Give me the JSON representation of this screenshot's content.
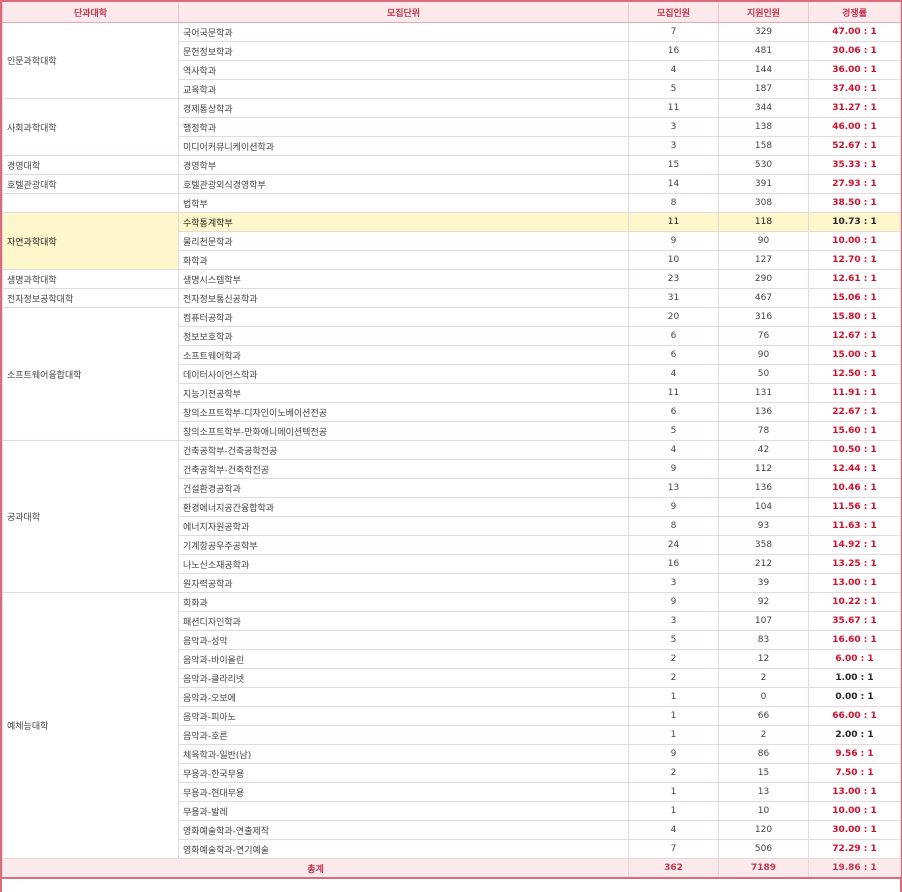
{
  "header": {
    "college": "단과대학",
    "dept": "모집단위",
    "quota": "모집인원",
    "applicants": "지원인원",
    "ratio": "경쟁률"
  },
  "colors": {
    "border": "#d96b7d",
    "header_bg": "#fbe9ec",
    "ratio_red": "#d0102a",
    "highlight_bg": "#fff7cc"
  },
  "highlight_college": "자연과학대학",
  "highlight_row": "수학통계학부",
  "low_ratio_rows": [
    "1.00 : 1",
    "0.00 : 1",
    "2.00 : 1"
  ],
  "colleges": [
    {
      "name": "인문과학대학",
      "rows": [
        {
          "dept": "국어국문학과",
          "quota": "7",
          "applicants": "329",
          "ratio": "47.00 : 1"
        },
        {
          "dept": "문헌정보학과",
          "quota": "16",
          "applicants": "481",
          "ratio": "30.06 : 1"
        },
        {
          "dept": "역사학과",
          "quota": "4",
          "applicants": "144",
          "ratio": "36.00 : 1"
        },
        {
          "dept": "교육학과",
          "quota": "5",
          "applicants": "187",
          "ratio": "37.40 : 1"
        }
      ]
    },
    {
      "name": "사회과학대학",
      "rows": [
        {
          "dept": "경제통상학과",
          "quota": "11",
          "applicants": "344",
          "ratio": "31.27 : 1"
        },
        {
          "dept": "행정학과",
          "quota": "3",
          "applicants": "138",
          "ratio": "46.00 : 1"
        },
        {
          "dept": "미디어커뮤니케이션학과",
          "quota": "3",
          "applicants": "158",
          "ratio": "52.67 : 1"
        }
      ]
    },
    {
      "name": "경영대학",
      "rows": [
        {
          "dept": "경영학부",
          "quota": "15",
          "applicants": "530",
          "ratio": "35.33 : 1"
        }
      ]
    },
    {
      "name": "호텔관광대학",
      "rows": [
        {
          "dept": "호텔관광외식경영학부",
          "quota": "14",
          "applicants": "391",
          "ratio": "27.93 : 1"
        }
      ]
    },
    {
      "name": "",
      "rows": [
        {
          "dept": "법학부",
          "quota": "8",
          "applicants": "308",
          "ratio": "38.50 : 1"
        }
      ]
    },
    {
      "name": "자연과학대학",
      "rows": [
        {
          "dept": "수학통계학부",
          "quota": "11",
          "applicants": "118",
          "ratio": "10.73 : 1"
        },
        {
          "dept": "물리천문학과",
          "quota": "9",
          "applicants": "90",
          "ratio": "10.00 : 1"
        },
        {
          "dept": "화학과",
          "quota": "10",
          "applicants": "127",
          "ratio": "12.70 : 1"
        }
      ]
    },
    {
      "name": "생명과학대학",
      "rows": [
        {
          "dept": "생명시스템학부",
          "quota": "23",
          "applicants": "290",
          "ratio": "12.61 : 1"
        }
      ]
    },
    {
      "name": "전자정보공학대학",
      "rows": [
        {
          "dept": "전자정보통신공학과",
          "quota": "31",
          "applicants": "467",
          "ratio": "15.06 : 1"
        }
      ]
    },
    {
      "name": "소프트웨어융합대학",
      "rows": [
        {
          "dept": "컴퓨터공학과",
          "quota": "20",
          "applicants": "316",
          "ratio": "15.80 : 1"
        },
        {
          "dept": "정보보호학과",
          "quota": "6",
          "applicants": "76",
          "ratio": "12.67 : 1"
        },
        {
          "dept": "소프트웨어학과",
          "quota": "6",
          "applicants": "90",
          "ratio": "15.00 : 1"
        },
        {
          "dept": "데이터사이언스학과",
          "quota": "4",
          "applicants": "50",
          "ratio": "12.50 : 1"
        },
        {
          "dept": "지능기전공학부",
          "quota": "11",
          "applicants": "131",
          "ratio": "11.91 : 1"
        },
        {
          "dept": "창의소프트학부-디자인이노베이션전공",
          "quota": "6",
          "applicants": "136",
          "ratio": "22.67 : 1"
        },
        {
          "dept": "창의소프트학부-만화애니메이션텍전공",
          "quota": "5",
          "applicants": "78",
          "ratio": "15.60 : 1"
        }
      ]
    },
    {
      "name": "공과대학",
      "rows": [
        {
          "dept": "건축공학부-건축공학전공",
          "quota": "4",
          "applicants": "42",
          "ratio": "10.50 : 1"
        },
        {
          "dept": "건축공학부-건축학전공",
          "quota": "9",
          "applicants": "112",
          "ratio": "12.44 : 1"
        },
        {
          "dept": "건설환경공학과",
          "quota": "13",
          "applicants": "136",
          "ratio": "10.46 : 1"
        },
        {
          "dept": "환경에너지공간융합학과",
          "quota": "9",
          "applicants": "104",
          "ratio": "11.56 : 1"
        },
        {
          "dept": "에너지자원공학과",
          "quota": "8",
          "applicants": "93",
          "ratio": "11.63 : 1"
        },
        {
          "dept": "기계항공우주공학부",
          "quota": "24",
          "applicants": "358",
          "ratio": "14.92 : 1"
        },
        {
          "dept": "나노신소재공학과",
          "quota": "16",
          "applicants": "212",
          "ratio": "13.25 : 1"
        },
        {
          "dept": "원자력공학과",
          "quota": "3",
          "applicants": "39",
          "ratio": "13.00 : 1"
        }
      ]
    },
    {
      "name": "예체능대학",
      "rows": [
        {
          "dept": "회화과",
          "quota": "9",
          "applicants": "92",
          "ratio": "10.22 : 1"
        },
        {
          "dept": "패션디자인학과",
          "quota": "3",
          "applicants": "107",
          "ratio": "35.67 : 1"
        },
        {
          "dept": "음악과-성악",
          "quota": "5",
          "applicants": "83",
          "ratio": "16.60 : 1"
        },
        {
          "dept": "음악과-바이올린",
          "quota": "2",
          "applicants": "12",
          "ratio": "6.00 : 1"
        },
        {
          "dept": "음악과-클라리넷",
          "quota": "2",
          "applicants": "2",
          "ratio": "1.00 : 1"
        },
        {
          "dept": "음악과-오보에",
          "quota": "1",
          "applicants": "0",
          "ratio": "0.00 : 1"
        },
        {
          "dept": "음악과-피아노",
          "quota": "1",
          "applicants": "66",
          "ratio": "66.00 : 1"
        },
        {
          "dept": "음악과-호른",
          "quota": "1",
          "applicants": "2",
          "ratio": "2.00 : 1"
        },
        {
          "dept": "체육학과-일반(남)",
          "quota": "9",
          "applicants": "86",
          "ratio": "9.56 : 1"
        },
        {
          "dept": "무용과-한국무용",
          "quota": "2",
          "applicants": "15",
          "ratio": "7.50 : 1"
        },
        {
          "dept": "무용과-현대무용",
          "quota": "1",
          "applicants": "13",
          "ratio": "13.00 : 1"
        },
        {
          "dept": "무용과-발레",
          "quota": "1",
          "applicants": "10",
          "ratio": "10.00 : 1"
        },
        {
          "dept": "영화예술학과-연출제작",
          "quota": "4",
          "applicants": "120",
          "ratio": "30.00 : 1"
        },
        {
          "dept": "영화예술학과-연기예술",
          "quota": "7",
          "applicants": "506",
          "ratio": "72.29 : 1"
        }
      ]
    }
  ],
  "total": {
    "label": "총계",
    "quota": "362",
    "applicants": "7189",
    "ratio": "19.86 : 1"
  }
}
